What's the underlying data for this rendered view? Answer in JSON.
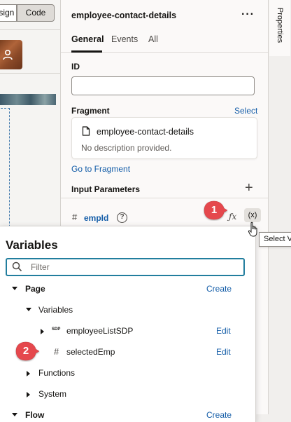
{
  "designer": {
    "design_toggle_label": "Design",
    "code_toggle_label": "Code"
  },
  "properties": {
    "title": "employee-contact-details",
    "more_icon": "more-horizontal-icon",
    "tabs": [
      {
        "label": "General",
        "selected": true
      },
      {
        "label": "Events",
        "selected": false
      },
      {
        "label": "All",
        "selected": false
      }
    ],
    "id_label": "ID",
    "id_value": "",
    "fragment_label": "Fragment",
    "fragment_select_label": "Select",
    "fragment_name": "employee-contact-details",
    "fragment_description": "No description provided.",
    "go_to_fragment_label": "Go to Fragment",
    "input_parameters_label": "Input Parameters",
    "param": {
      "name": "empId",
      "fx_label": "ƒx",
      "variable_button_label": "(x)"
    }
  },
  "side_rail": {
    "properties_label": "Properties"
  },
  "tooltip": {
    "text": "Select V"
  },
  "callouts": {
    "first": "1",
    "second": "2"
  },
  "variables_popup": {
    "title": "Variables",
    "filter_placeholder": "Filter",
    "filter_value": "",
    "tree": {
      "page_label": "Page",
      "page_create": "Create",
      "variables_label": "Variables",
      "sdp_badge": "SDP",
      "employee_list_sdp": "employeeListSDP",
      "employee_list_sdp_edit": "Edit",
      "selected_emp": "selectedEmp",
      "selected_emp_edit": "Edit",
      "functions_label": "Functions",
      "system_label": "System",
      "flow_label": "Flow",
      "flow_create": "Create"
    }
  },
  "colors": {
    "link": "#145da8",
    "callout": "#e5484d",
    "filter_focus": "#227e9e"
  }
}
